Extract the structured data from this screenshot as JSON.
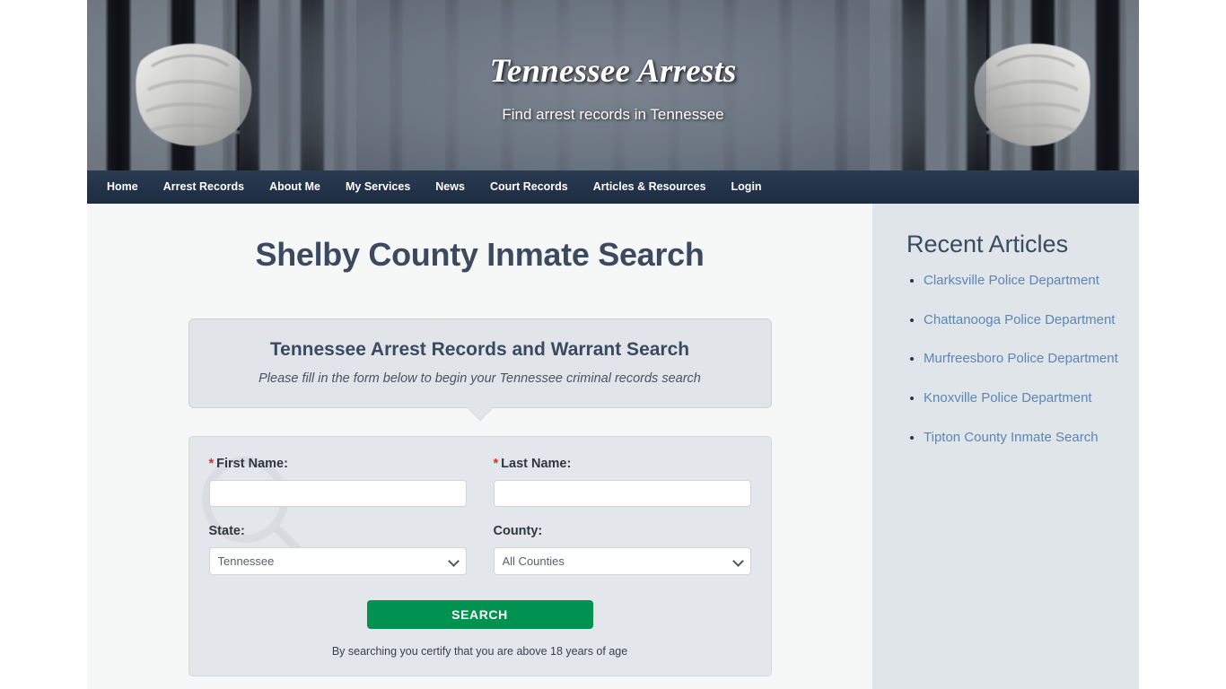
{
  "colors": {
    "nav_bg": "#223249",
    "accent_green": "#019150",
    "heading": "#3c4a5f",
    "link_blue": "#5b86b5",
    "required_red": "#e02b2b",
    "sidebar_bg": "#e0e5ea",
    "panel_bg": "#e3e7eb"
  },
  "banner": {
    "title": "Tennessee Arrests",
    "tagline": "Find arrest records in Tennessee"
  },
  "nav": {
    "items": [
      {
        "label": "Home"
      },
      {
        "label": "Arrest Records"
      },
      {
        "label": "About Me"
      },
      {
        "label": "My Services"
      },
      {
        "label": "News"
      },
      {
        "label": "Court Records"
      },
      {
        "label": "Articles & Resources"
      },
      {
        "label": "Login"
      }
    ]
  },
  "main": {
    "page_title": "Shelby County Inmate Search",
    "callout": {
      "title": "Tennessee Arrest Records and Warrant Search",
      "subtitle": "Please fill in the form below to begin your Tennessee criminal records search"
    },
    "form": {
      "first_name": {
        "label": "First Name:",
        "required_marker": "*",
        "value": "",
        "placeholder": ""
      },
      "last_name": {
        "label": "Last Name:",
        "required_marker": "*",
        "value": "",
        "placeholder": ""
      },
      "state": {
        "label": "State:",
        "selected": "Tennessee",
        "options": [
          "Tennessee"
        ]
      },
      "county": {
        "label": "County:",
        "selected": "All Counties",
        "options": [
          "All Counties"
        ]
      },
      "submit_label": "SEARCH",
      "disclaimer": "By searching you certify that you are above 18 years of age"
    }
  },
  "sidebar": {
    "title": "Recent Articles",
    "articles": [
      {
        "label": "Clarksville Police Department"
      },
      {
        "label": "Chattanooga Police Department"
      },
      {
        "label": "Murfreesboro Police Department"
      },
      {
        "label": "Knoxville Police Department"
      },
      {
        "label": "Tipton County Inmate Search"
      }
    ]
  }
}
